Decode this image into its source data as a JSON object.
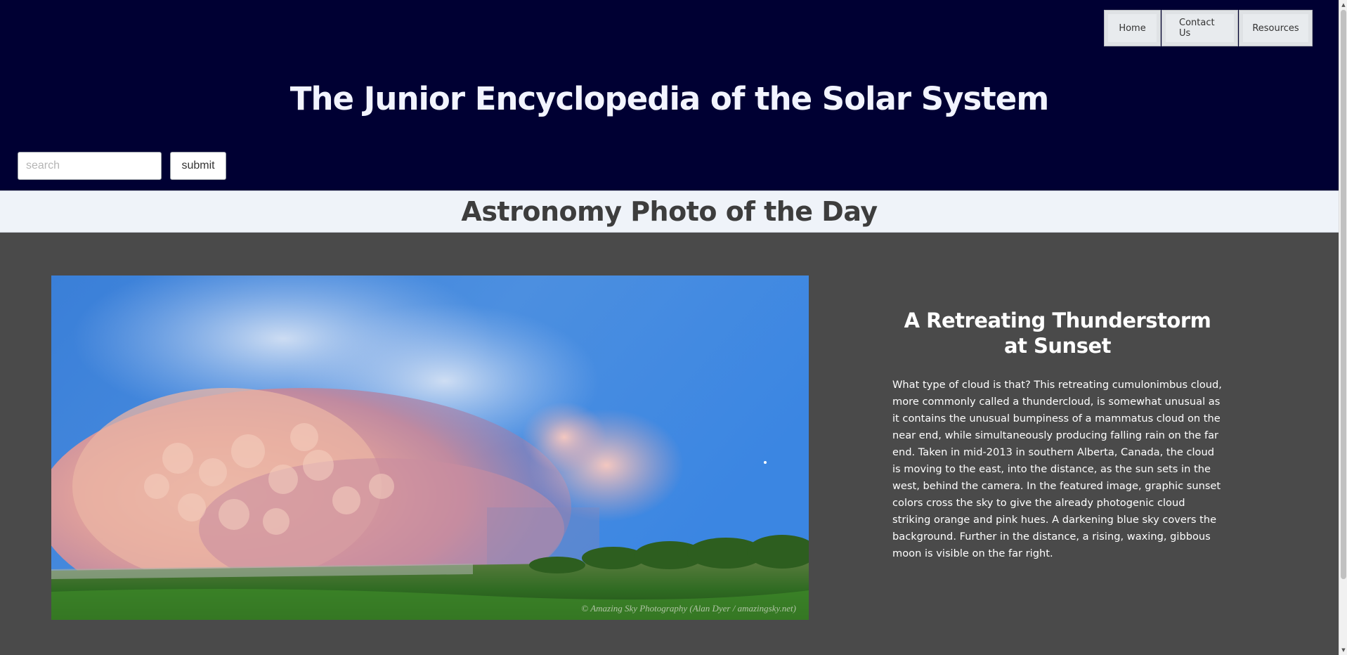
{
  "nav": {
    "items": [
      {
        "label": "Home"
      },
      {
        "label": "Contact Us"
      },
      {
        "label": "Resources"
      }
    ]
  },
  "header": {
    "title": "The Junior Encyclopedia of the Solar System"
  },
  "search": {
    "placeholder": "search",
    "value": "",
    "submit_label": "submit"
  },
  "section": {
    "title": "Astronomy Photo of the Day"
  },
  "photo": {
    "credit": "© Amazing Sky Photography (Alan Dyer / amazingsky.net)"
  },
  "article": {
    "title": "A Retreating Thunderstorm at Sunset",
    "body": "What type of cloud is that? This retreating cumulonimbus cloud, more commonly called a thundercloud, is somewhat unusual as it contains the unusual bumpiness of a mammatus cloud on the near end, while simultaneously producing falling rain on the far end. Taken in mid-2013 in southern Alberta, Canada, the cloud is moving to the east, into the distance, as the sun sets in the west, behind the camera. In the featured image, graphic sunset colors cross the sky to give the already photogenic cloud striking orange and pink hues. A darkening blue sky covers the background. Further in the distance, a rising, waxing, gibbous moon is visible on the far right."
  },
  "colors": {
    "header_bg": "#000033",
    "section_bar_bg": "#eff3f9",
    "content_bg": "#4a4a4a"
  },
  "icons": {
    "scroll_up": "▲",
    "scroll_down": "▼"
  }
}
